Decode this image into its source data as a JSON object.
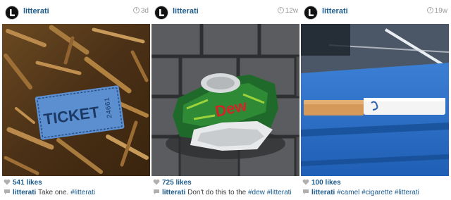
{
  "posts": [
    {
      "user": "litterati",
      "age": "3d",
      "likes": "541 likes",
      "caption_user": "litterati",
      "caption_text": " Take one. ",
      "caption_tags": "#litterati",
      "photo": {
        "ticket_text": "TICKET",
        "ticket_number": "24661"
      }
    },
    {
      "user": "litterati",
      "age": "12w",
      "likes": "725 likes",
      "caption_user": "litterati",
      "caption_text": " Don't do this to the ",
      "caption_tags": "#dew #litterati",
      "photo": {
        "can_text": "Dew"
      }
    },
    {
      "user": "litterati",
      "age": "19w",
      "likes": "100 likes",
      "caption_user": "litterati",
      "caption_text": " ",
      "caption_tags": "#camel #cigarette #litterati",
      "photo": {}
    }
  ],
  "icons": {
    "avatar": "litterati-logo-icon",
    "time": "clock-icon",
    "likes": "heart-icon",
    "caption": "comment-icon"
  },
  "colors": {
    "link": "#1c5b8c",
    "text": "#3f3f3f",
    "muted": "#9a9a9a"
  }
}
